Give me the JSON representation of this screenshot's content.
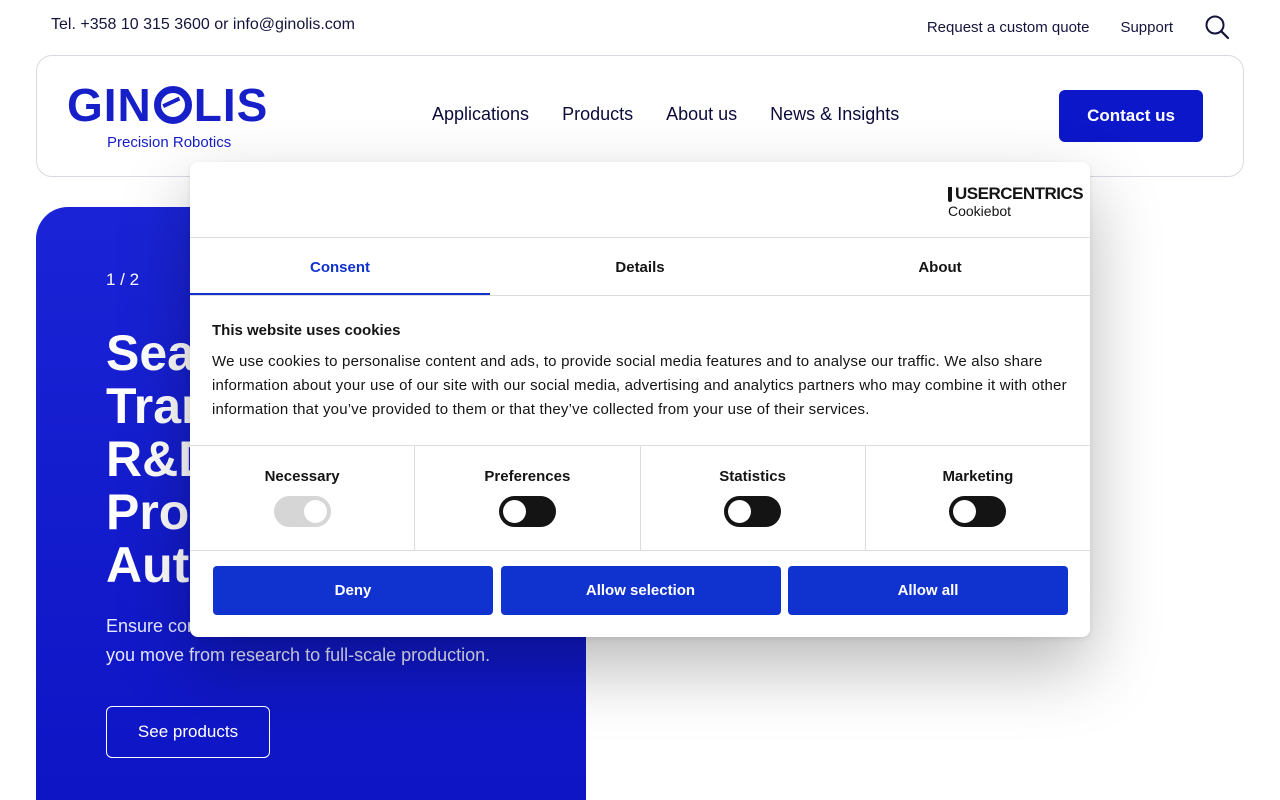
{
  "topbar": {
    "contact_text": "Tel. +358 10 315 3600 or info@ginolis.com",
    "links": [
      "Request a custom quote",
      "Support"
    ],
    "search_icon": "search-icon"
  },
  "header": {
    "logo_text": "GINOLIS",
    "logo_tagline": "Precision Robotics",
    "nav": [
      "Applications",
      "Products",
      "About us",
      "News & Insights"
    ],
    "contact_button": "Contact us"
  },
  "hero": {
    "pager": "1 / 2",
    "title_lines": [
      "Sea",
      "Tran",
      "R&D",
      "Proc",
      "Auto"
    ],
    "subtitle": "Ensure con… you move from research to full-scale production.",
    "subtitle_line1": "Ensure con",
    "subtitle_line2": "you move from research to full-scale production.",
    "button": "See products"
  },
  "cookie_dialog": {
    "brand_top": "USERCENTRICS",
    "brand_bottom": "Cookiebot",
    "tabs": [
      "Consent",
      "Details",
      "About"
    ],
    "active_tab": "Consent",
    "heading": "This website uses cookies",
    "description": "We use cookies to personalise content and ads, to provide social media features and to analyse our traffic. We also share information about your use of our site with our social media, advertising and analytics partners who may combine it with other information that you’ve provided to them or that they’ve collected from your use of their services.",
    "toggles": [
      {
        "label": "Necessary",
        "checked": true,
        "disabled": true
      },
      {
        "label": "Preferences",
        "checked": false,
        "disabled": false
      },
      {
        "label": "Statistics",
        "checked": false,
        "disabled": false
      },
      {
        "label": "Marketing",
        "checked": false,
        "disabled": false
      }
    ],
    "buttons": [
      "Deny",
      "Allow selection",
      "Allow all"
    ]
  },
  "colors": {
    "brand_blue": "#0c17c9",
    "cookie_blue": "#1032cf",
    "text_dark": "#0b0b3a"
  }
}
